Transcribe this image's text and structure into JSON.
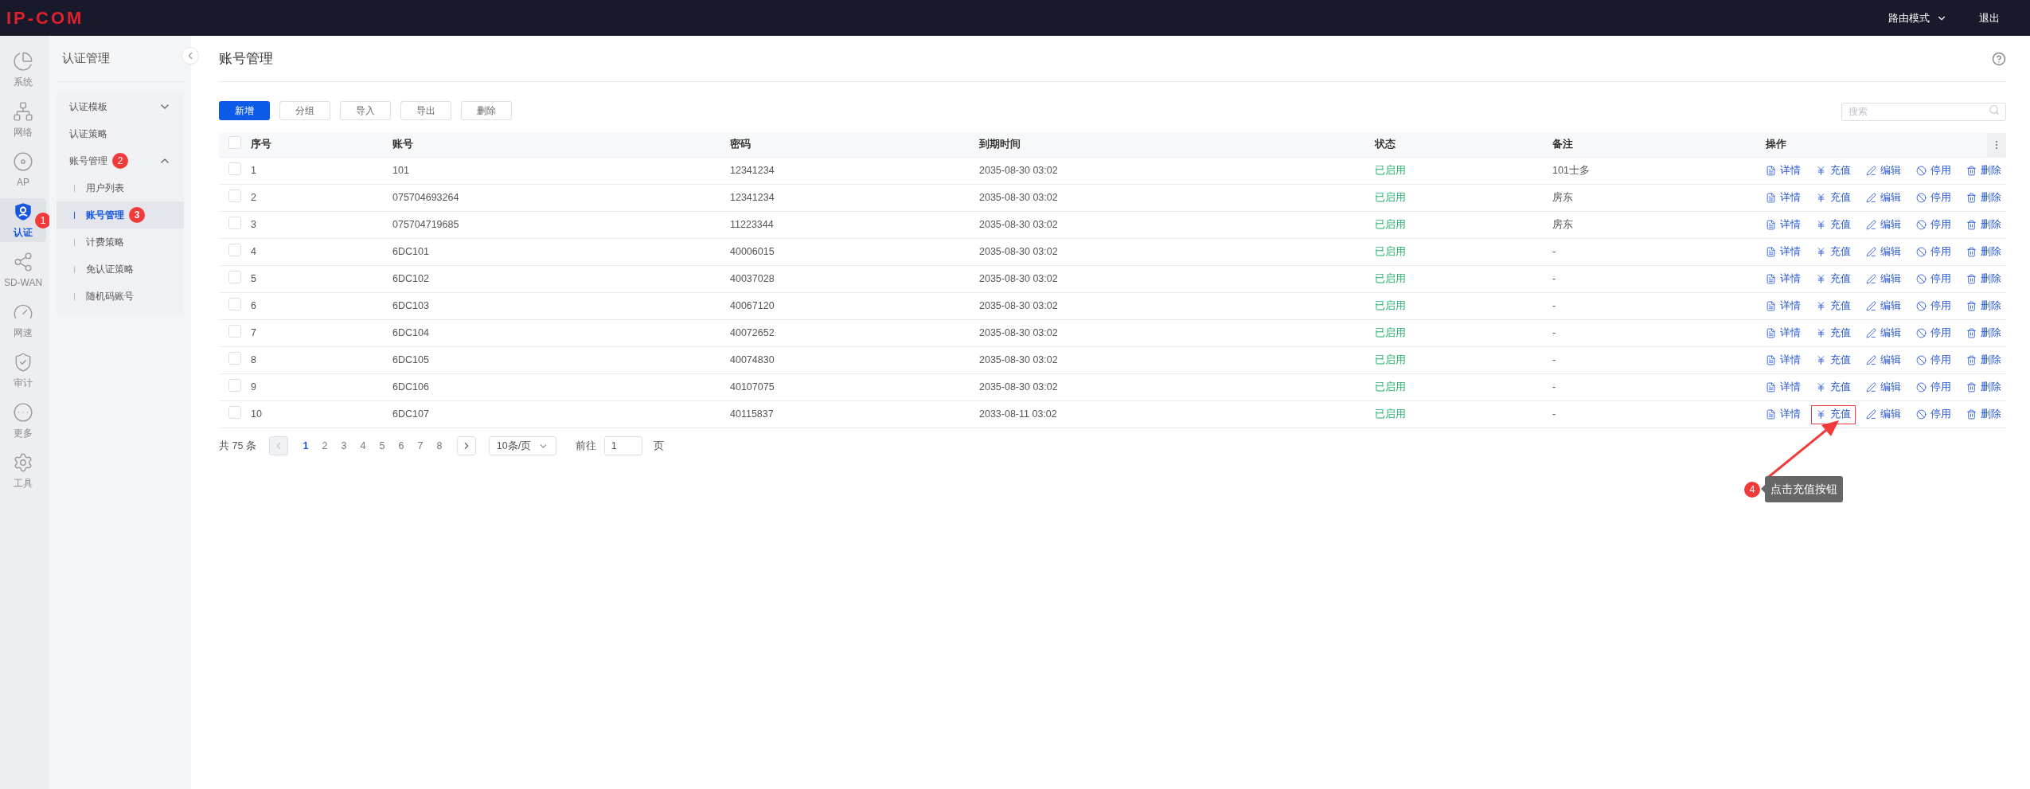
{
  "header": {
    "logo": "IP-COM",
    "mode": "路由模式",
    "logout": "退出"
  },
  "rail": [
    {
      "label": "系统",
      "selected": false
    },
    {
      "label": "网络",
      "selected": false
    },
    {
      "label": "AP",
      "selected": false
    },
    {
      "label": "认证",
      "selected": true,
      "badge": "1"
    },
    {
      "label": "SD-WAN",
      "selected": false
    },
    {
      "label": "网速",
      "selected": false
    },
    {
      "label": "审计",
      "selected": false
    },
    {
      "label": "更多",
      "selected": false
    },
    {
      "label": "工具",
      "selected": false
    }
  ],
  "sidebar": {
    "title": "认证管理",
    "items": [
      {
        "label": "认证模板",
        "expanded": false,
        "selected": false
      },
      {
        "label": "认证策略",
        "selected": false
      },
      {
        "label": "账号管理",
        "expanded": true,
        "selected": false,
        "badge": "2",
        "children": [
          {
            "label": "用户列表",
            "selected": false
          },
          {
            "label": "账号管理",
            "selected": true,
            "badge": "3"
          },
          {
            "label": "计费策略",
            "selected": false
          },
          {
            "label": "免认证策略",
            "selected": false
          },
          {
            "label": "随机码账号",
            "selected": false
          }
        ]
      }
    ]
  },
  "page": {
    "title": "账号管理"
  },
  "toolbar": {
    "buttons": [
      {
        "label": "新增",
        "kind": "primary"
      },
      {
        "label": "分组",
        "kind": "default"
      },
      {
        "label": "导入",
        "kind": "default"
      },
      {
        "label": "导出",
        "kind": "default"
      },
      {
        "label": "删除",
        "kind": "default"
      }
    ],
    "search": {
      "placeholder": "搜索"
    }
  },
  "table": {
    "select_all": {
      "checked": false
    },
    "columns": [
      "序号",
      "账号",
      "密码",
      "到期时间",
      "状态",
      "备注",
      "操作"
    ],
    "rows": [
      {
        "checked": false,
        "cells": [
          "1",
          "101",
          "12341234",
          "2035-08-30 03:02",
          "已启用",
          "101士多"
        ],
        "actions": [
          {
            "label": "详情",
            "highlighted": false
          },
          {
            "label": "充值",
            "highlighted": false
          },
          {
            "label": "编辑",
            "highlighted": false
          },
          {
            "label": "停用",
            "highlighted": false
          },
          {
            "label": "删除",
            "highlighted": false
          }
        ]
      },
      {
        "checked": false,
        "cells": [
          "2",
          "075704693264",
          "12341234",
          "2035-08-30 03:02",
          "已启用",
          "房东"
        ],
        "actions": [
          {
            "label": "详情",
            "highlighted": false
          },
          {
            "label": "充值",
            "highlighted": false
          },
          {
            "label": "编辑",
            "highlighted": false
          },
          {
            "label": "停用",
            "highlighted": false
          },
          {
            "label": "删除",
            "highlighted": false
          }
        ]
      },
      {
        "checked": false,
        "cells": [
          "3",
          "075704719685",
          "11223344",
          "2035-08-30 03:02",
          "已启用",
          "房东"
        ],
        "actions": [
          {
            "label": "详情",
            "highlighted": false
          },
          {
            "label": "充值",
            "highlighted": false
          },
          {
            "label": "编辑",
            "highlighted": false
          },
          {
            "label": "停用",
            "highlighted": false
          },
          {
            "label": "删除",
            "highlighted": false
          }
        ]
      },
      {
        "checked": false,
        "cells": [
          "4",
          "6DC101",
          "40006015",
          "2035-08-30 03:02",
          "已启用",
          "-"
        ],
        "actions": [
          {
            "label": "详情",
            "highlighted": false
          },
          {
            "label": "充值",
            "highlighted": false
          },
          {
            "label": "编辑",
            "highlighted": false
          },
          {
            "label": "停用",
            "highlighted": false
          },
          {
            "label": "删除",
            "highlighted": false
          }
        ]
      },
      {
        "checked": false,
        "cells": [
          "5",
          "6DC102",
          "40037028",
          "2035-08-30 03:02",
          "已启用",
          "-"
        ],
        "actions": [
          {
            "label": "详情",
            "highlighted": false
          },
          {
            "label": "充值",
            "highlighted": false
          },
          {
            "label": "编辑",
            "highlighted": false
          },
          {
            "label": "停用",
            "highlighted": false
          },
          {
            "label": "删除",
            "highlighted": false
          }
        ]
      },
      {
        "checked": false,
        "cells": [
          "6",
          "6DC103",
          "40067120",
          "2035-08-30 03:02",
          "已启用",
          "-"
        ],
        "actions": [
          {
            "label": "详情",
            "highlighted": false
          },
          {
            "label": "充值",
            "highlighted": false
          },
          {
            "label": "编辑",
            "highlighted": false
          },
          {
            "label": "停用",
            "highlighted": false
          },
          {
            "label": "删除",
            "highlighted": false
          }
        ]
      },
      {
        "checked": false,
        "cells": [
          "7",
          "6DC104",
          "40072652",
          "2035-08-30 03:02",
          "已启用",
          "-"
        ],
        "actions": [
          {
            "label": "详情",
            "highlighted": false
          },
          {
            "label": "充值",
            "highlighted": false
          },
          {
            "label": "编辑",
            "highlighted": false
          },
          {
            "label": "停用",
            "highlighted": false
          },
          {
            "label": "删除",
            "highlighted": false
          }
        ]
      },
      {
        "checked": false,
        "cells": [
          "8",
          "6DC105",
          "40074830",
          "2035-08-30 03:02",
          "已启用",
          "-"
        ],
        "actions": [
          {
            "label": "详情",
            "highlighted": false
          },
          {
            "label": "充值",
            "highlighted": false
          },
          {
            "label": "编辑",
            "highlighted": false
          },
          {
            "label": "停用",
            "highlighted": false
          },
          {
            "label": "删除",
            "highlighted": false
          }
        ]
      },
      {
        "checked": false,
        "cells": [
          "9",
          "6DC106",
          "40107075",
          "2035-08-30 03:02",
          "已启用",
          "-"
        ],
        "actions": [
          {
            "label": "详情",
            "highlighted": false
          },
          {
            "label": "充值",
            "highlighted": false
          },
          {
            "label": "编辑",
            "highlighted": false
          },
          {
            "label": "停用",
            "highlighted": false
          },
          {
            "label": "删除",
            "highlighted": false
          }
        ]
      },
      {
        "checked": false,
        "cells": [
          "10",
          "6DC107",
          "40115837",
          "2033-08-11 03:02",
          "已启用",
          "-"
        ],
        "actions": [
          {
            "label": "详情",
            "highlighted": false
          },
          {
            "label": "充值",
            "highlighted": true
          },
          {
            "label": "编辑",
            "highlighted": false
          },
          {
            "label": "停用",
            "highlighted": false
          },
          {
            "label": "删除",
            "highlighted": false
          }
        ]
      }
    ]
  },
  "pagination": {
    "total": "共 75 条",
    "prev": {
      "disabled": true
    },
    "next": {
      "disabled": false
    },
    "pages": [
      {
        "label": "1",
        "selected": true
      },
      {
        "label": "2",
        "selected": false
      },
      {
        "label": "3",
        "selected": false
      },
      {
        "label": "4",
        "selected": false
      },
      {
        "label": "5",
        "selected": false
      },
      {
        "label": "6",
        "selected": false
      },
      {
        "label": "7",
        "selected": false
      },
      {
        "label": "8",
        "selected": false
      }
    ],
    "page_size": "10条/页",
    "goto_label": "前往",
    "goto_value": "1",
    "goto_suffix": "页"
  },
  "callout": {
    "badge": "4",
    "text": "点击充值按钮"
  }
}
